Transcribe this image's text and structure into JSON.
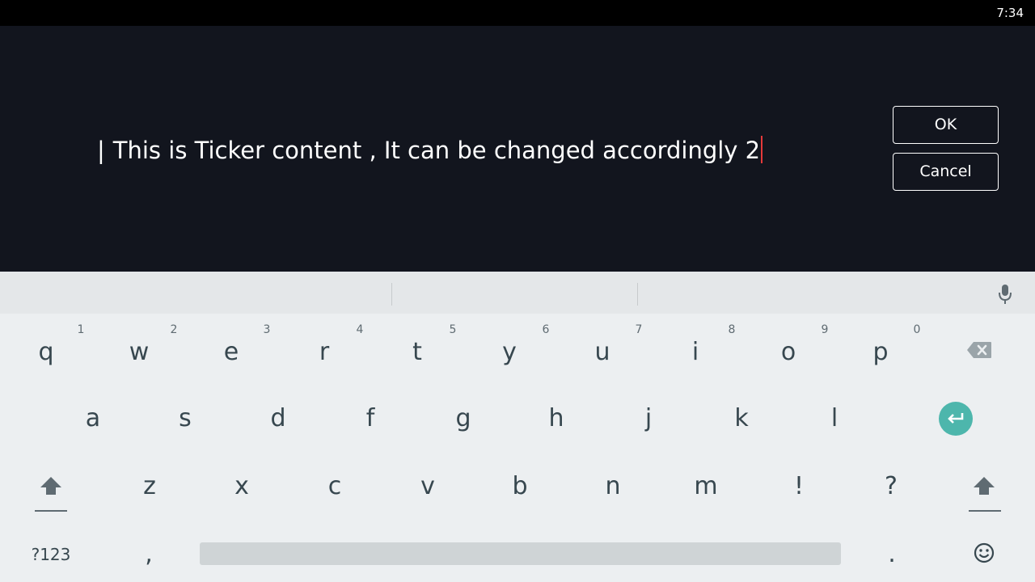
{
  "status_bar": {
    "time": "7:34"
  },
  "editor": {
    "lead_bar": "|",
    "text": "This is Ticker content , It can be changed accordingly 2"
  },
  "dialog": {
    "ok_label": "OK",
    "cancel_label": "Cancel"
  },
  "keyboard": {
    "row1": [
      "q",
      "w",
      "e",
      "r",
      "t",
      "y",
      "u",
      "i",
      "o",
      "p"
    ],
    "row1_hints": [
      "1",
      "2",
      "3",
      "4",
      "5",
      "6",
      "7",
      "8",
      "9",
      "0"
    ],
    "row2": [
      "a",
      "s",
      "d",
      "f",
      "g",
      "h",
      "j",
      "k",
      "l"
    ],
    "row3": [
      "z",
      "x",
      "c",
      "v",
      "b",
      "n",
      "m",
      "!",
      "?"
    ],
    "symbols_label": "?123",
    "comma_label": ",",
    "period_label": ".",
    "icons": {
      "mic": "microphone-icon",
      "backspace": "backspace-icon",
      "enter": "enter-icon",
      "shift": "shift-icon",
      "emoji": "emoji-icon"
    },
    "colors": {
      "enter_key": "#4db6ac",
      "cursor": "#e5393a"
    }
  }
}
